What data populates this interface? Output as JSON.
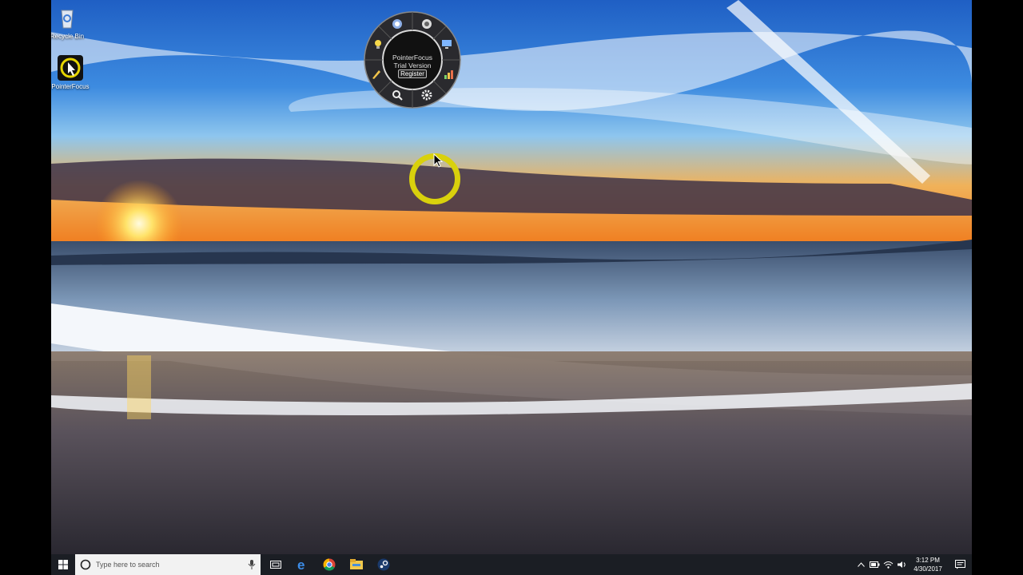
{
  "desktop": {
    "icons": [
      {
        "label": "Recycle Bin",
        "icon": "recycle-bin-icon"
      },
      {
        "label": "PointerFocus",
        "icon": "pointerfocus-app-icon"
      }
    ]
  },
  "radial_menu": {
    "app_name": "PointerFocus",
    "edition": "Trial Version",
    "register_label": "Register",
    "tools": [
      "magnifier-icon",
      "spotlight-icon",
      "bulb-icon",
      "pen-icon",
      "zoom-icon",
      "settings-icon",
      "keystroke-icon",
      "screen-icon"
    ]
  },
  "pointer": {
    "highlight_color": "#d9d10c"
  },
  "taskbar": {
    "search_placeholder": "Type here to search",
    "pinned": [
      "task-view-icon",
      "edge-icon",
      "chrome-icon",
      "file-explorer-icon",
      "steam-icon"
    ],
    "clock_time": "3:12 PM",
    "clock_date": "4/30/2017"
  },
  "colors": {
    "taskbar_bg": "#1b1e24",
    "search_bg": "#f2f2f2",
    "accent_yellow": "#d9d10c"
  }
}
